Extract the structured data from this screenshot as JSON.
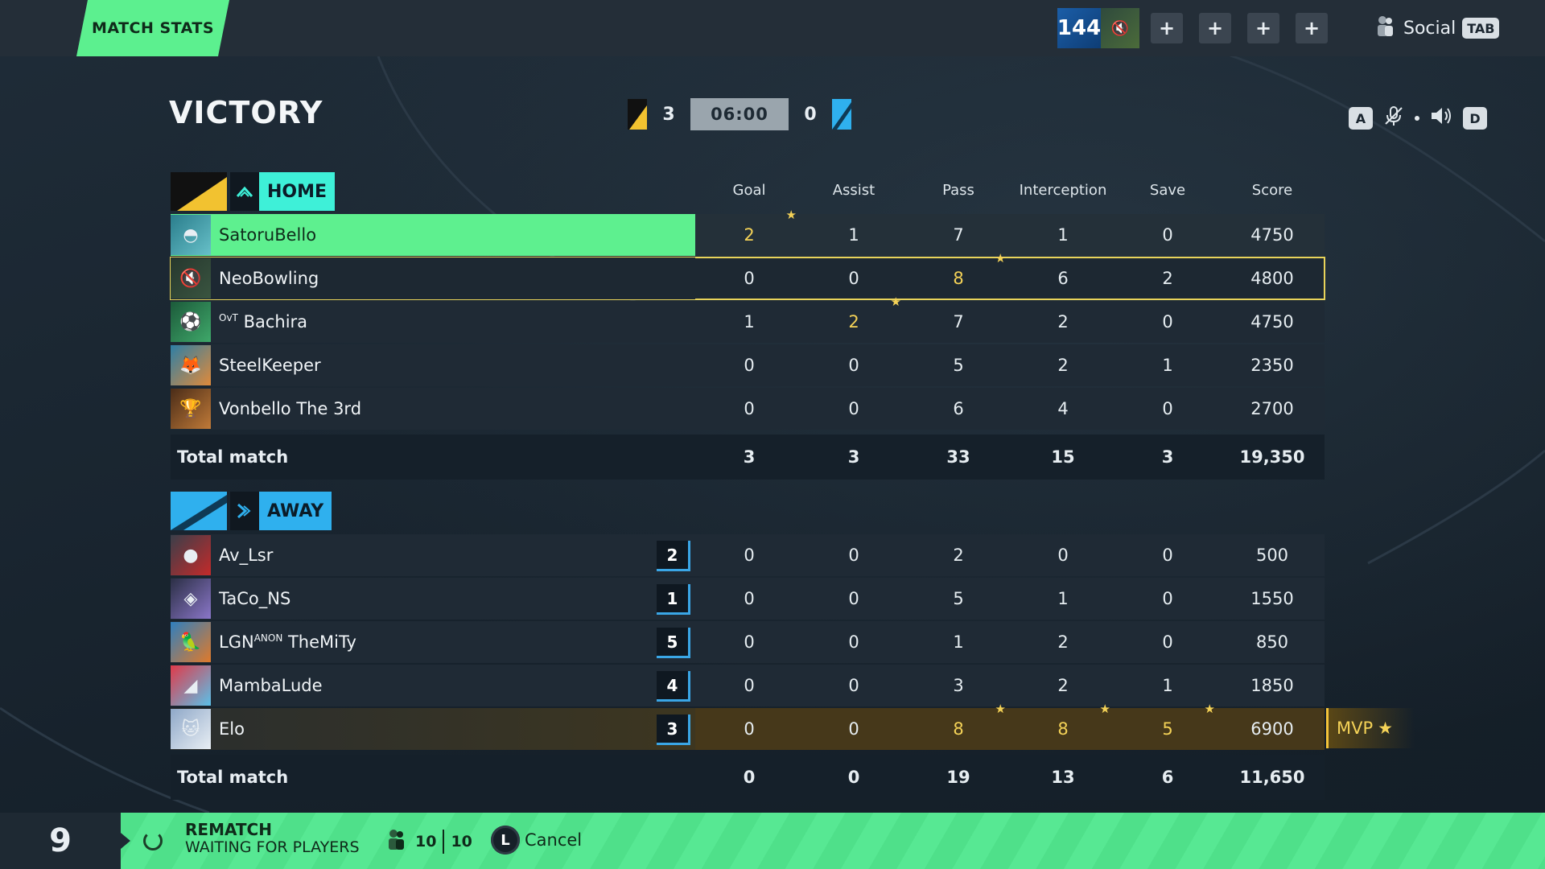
{
  "topbar": {
    "tab_label": "MATCH STATS",
    "level": "144",
    "social_label": "Social",
    "social_key": "TAB",
    "plus": "+"
  },
  "header": {
    "result": "VICTORY",
    "home_score": "3",
    "timer": "06:00",
    "away_score": "0",
    "key_left": "A",
    "key_right": "D"
  },
  "columns": [
    "Goal",
    "Assist",
    "Pass",
    "Interception",
    "Save",
    "Score"
  ],
  "home": {
    "label": "HOME",
    "players": [
      {
        "name": "SatoruBello",
        "tag": "",
        "stats": [
          "2",
          "1",
          "7",
          "1",
          "0",
          "4750"
        ],
        "best": [
          0
        ]
      },
      {
        "name": "NeoBowling",
        "tag": "",
        "stats": [
          "0",
          "0",
          "8",
          "6",
          "2",
          "4800"
        ],
        "best": [
          2
        ]
      },
      {
        "name": "Bachira",
        "tag": "OvT",
        "stats": [
          "1",
          "2",
          "7",
          "2",
          "0",
          "4750"
        ],
        "best": [
          1
        ]
      },
      {
        "name": "SteelKeeper",
        "tag": "",
        "stats": [
          "0",
          "0",
          "5",
          "2",
          "1",
          "2350"
        ],
        "best": []
      },
      {
        "name": "Vonbello The 3rd",
        "tag": "",
        "stats": [
          "0",
          "0",
          "6",
          "4",
          "0",
          "2700"
        ],
        "best": []
      }
    ],
    "total_label": "Total match",
    "totals": [
      "3",
      "3",
      "33",
      "15",
      "3",
      "19,350"
    ]
  },
  "away": {
    "label": "AWAY",
    "players": [
      {
        "name": "Av_Lsr",
        "tag": "",
        "rank": "2",
        "stats": [
          "0",
          "0",
          "2",
          "0",
          "0",
          "500"
        ],
        "best": []
      },
      {
        "name": "TaCo_NS",
        "tag": "",
        "rank": "1",
        "stats": [
          "0",
          "0",
          "5",
          "1",
          "0",
          "1550"
        ],
        "best": []
      },
      {
        "name": "TheMiTy",
        "tag": "LGN",
        "tag_sup": "ANON",
        "rank": "5",
        "stats": [
          "0",
          "0",
          "1",
          "2",
          "0",
          "850"
        ],
        "best": []
      },
      {
        "name": "MambaLude",
        "tag": "",
        "rank": "4",
        "stats": [
          "0",
          "0",
          "3",
          "2",
          "1",
          "1850"
        ],
        "best": []
      },
      {
        "name": "Elo",
        "tag": "",
        "rank": "3",
        "stats": [
          "0",
          "0",
          "8",
          "8",
          "5",
          "6900"
        ],
        "best": [
          2,
          3,
          4
        ]
      }
    ],
    "total_label": "Total match",
    "totals": [
      "0",
      "0",
      "19",
      "13",
      "6",
      "11,650"
    ]
  },
  "mvp_label": "MVP",
  "bottom": {
    "countdown": "9",
    "rematch": "REMATCH",
    "waiting": "WAITING FOR PLAYERS",
    "ready": "10",
    "total": "10",
    "cancel_key": "L",
    "cancel": "Cancel"
  },
  "colors": {
    "accent_green": "#5cf08f",
    "home_cyan": "#3ef0d8",
    "away_blue": "#2fb0ee",
    "gold": "#f4d257"
  }
}
